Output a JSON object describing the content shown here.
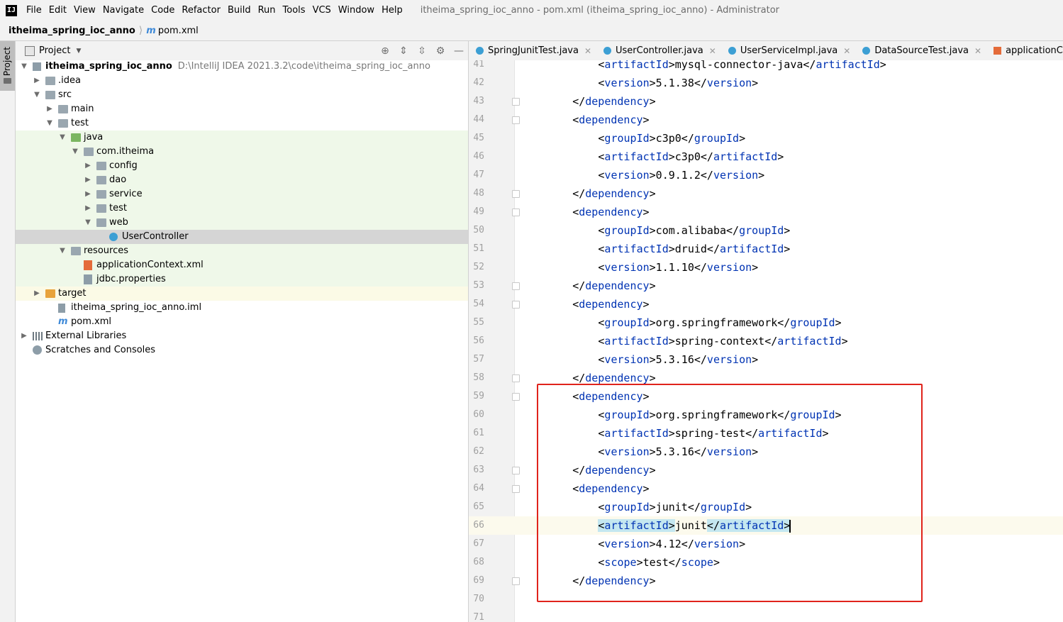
{
  "app": {
    "logo": "IJ",
    "menu": [
      "File",
      "Edit",
      "View",
      "Navigate",
      "Code",
      "Refactor",
      "Build",
      "Run",
      "Tools",
      "VCS",
      "Window",
      "Help"
    ],
    "window_title": "itheima_spring_ioc_anno - pom.xml (itheima_spring_ioc_anno) - Administrator"
  },
  "breadcrumb": {
    "project": "itheima_spring_ioc_anno",
    "file": "pom.xml",
    "file_icon": "m"
  },
  "toolstrip": {
    "project_label": "Project"
  },
  "project_panel": {
    "title": "Project",
    "header_icons": [
      "target-icon",
      "expand-all-icon",
      "collapse-all-icon",
      "gear-icon",
      "minimize-icon"
    ],
    "root": {
      "name": "itheima_spring_ioc_anno",
      "path": "D:\\IntelliJ IDEA 2021.3.2\\code\\itheima_spring_ioc_anno"
    },
    "tree": [
      {
        "label": ".idea",
        "depth": 1,
        "arrow": "right",
        "icon": "folder",
        "bg": ""
      },
      {
        "label": "src",
        "depth": 1,
        "arrow": "down",
        "icon": "folder",
        "bg": ""
      },
      {
        "label": "main",
        "depth": 2,
        "arrow": "right",
        "icon": "folder",
        "bg": ""
      },
      {
        "label": "test",
        "depth": 2,
        "arrow": "down",
        "icon": "folder",
        "bg": ""
      },
      {
        "label": "java",
        "depth": 3,
        "arrow": "down",
        "icon": "folder-green",
        "bg": "green"
      },
      {
        "label": "com.itheima",
        "depth": 4,
        "arrow": "down",
        "icon": "folder",
        "bg": "green"
      },
      {
        "label": "config",
        "depth": 5,
        "arrow": "right",
        "icon": "folder",
        "bg": "green"
      },
      {
        "label": "dao",
        "depth": 5,
        "arrow": "right",
        "icon": "folder",
        "bg": "green"
      },
      {
        "label": "service",
        "depth": 5,
        "arrow": "right",
        "icon": "folder",
        "bg": "green"
      },
      {
        "label": "test",
        "depth": 5,
        "arrow": "right",
        "icon": "folder",
        "bg": "green"
      },
      {
        "label": "web",
        "depth": 5,
        "arrow": "down",
        "icon": "folder",
        "bg": "green"
      },
      {
        "label": "UserController",
        "depth": 6,
        "arrow": "",
        "icon": "class",
        "bg": "selected"
      },
      {
        "label": "resources",
        "depth": 3,
        "arrow": "down",
        "icon": "folder-res",
        "bg": "green"
      },
      {
        "label": "applicationContext.xml",
        "depth": 4,
        "arrow": "",
        "icon": "xml",
        "bg": "green"
      },
      {
        "label": "jdbc.properties",
        "depth": 4,
        "arrow": "",
        "icon": "props",
        "bg": "green"
      },
      {
        "label": "target",
        "depth": 1,
        "arrow": "right",
        "icon": "folder-orange",
        "bg": "yellow"
      },
      {
        "label": "itheima_spring_ioc_anno.iml",
        "depth": 2,
        "arrow": "",
        "icon": "iml",
        "bg": ""
      },
      {
        "label": "pom.xml",
        "depth": 2,
        "arrow": "",
        "icon": "maven",
        "bg": ""
      },
      {
        "label": "External Libraries",
        "depth": 0,
        "arrow": "right",
        "icon": "lib",
        "bg": ""
      },
      {
        "label": "Scratches and Consoles",
        "depth": 0,
        "arrow": "",
        "icon": "scratch",
        "bg": ""
      }
    ]
  },
  "editor": {
    "tabs": [
      {
        "label": "SpringJunitTest.java",
        "icon": "class"
      },
      {
        "label": "UserController.java",
        "icon": "class"
      },
      {
        "label": "UserServiceImpl.java",
        "icon": "class"
      },
      {
        "label": "DataSourceTest.java",
        "icon": "class"
      },
      {
        "label": "applicationContext.xml",
        "icon": "xml"
      }
    ],
    "lines": [
      {
        "n": "41",
        "indent": 2,
        "open": "artifactId",
        "text": "mysql-connector-java",
        "fold": false
      },
      {
        "n": "42",
        "indent": 2,
        "open": "version",
        "text": "5.1.38",
        "fold": false
      },
      {
        "n": "43",
        "indent": 1,
        "close": "dependency",
        "fold": true
      },
      {
        "n": "44",
        "indent": 1,
        "tagonly": "dependency",
        "fold": true
      },
      {
        "n": "45",
        "indent": 2,
        "open": "groupId",
        "text": "c3p0",
        "fold": false
      },
      {
        "n": "46",
        "indent": 2,
        "open": "artifactId",
        "text": "c3p0",
        "fold": false
      },
      {
        "n": "47",
        "indent": 2,
        "open": "version",
        "text": "0.9.1.2",
        "fold": false
      },
      {
        "n": "48",
        "indent": 1,
        "close": "dependency",
        "fold": true
      },
      {
        "n": "49",
        "indent": 1,
        "tagonly": "dependency",
        "fold": true
      },
      {
        "n": "50",
        "indent": 2,
        "open": "groupId",
        "text": "com.alibaba",
        "fold": false
      },
      {
        "n": "51",
        "indent": 2,
        "open": "artifactId",
        "text": "druid",
        "fold": false
      },
      {
        "n": "52",
        "indent": 2,
        "open": "version",
        "text": "1.1.10",
        "fold": false
      },
      {
        "n": "53",
        "indent": 1,
        "close": "dependency",
        "fold": true
      },
      {
        "n": "54",
        "indent": 1,
        "tagonly": "dependency",
        "fold": true
      },
      {
        "n": "55",
        "indent": 2,
        "open": "groupId",
        "text": "org.springframework",
        "fold": false
      },
      {
        "n": "56",
        "indent": 2,
        "open": "artifactId",
        "text": "spring-context",
        "fold": false
      },
      {
        "n": "57",
        "indent": 2,
        "open": "version",
        "text": "5.3.16",
        "fold": false
      },
      {
        "n": "58",
        "indent": 1,
        "close": "dependency",
        "fold": true
      },
      {
        "n": "59",
        "indent": 1,
        "tagonly": "dependency",
        "fold": true
      },
      {
        "n": "60",
        "indent": 2,
        "open": "groupId",
        "text": "org.springframework",
        "fold": false
      },
      {
        "n": "61",
        "indent": 2,
        "open": "artifactId",
        "text": "spring-test",
        "fold": false
      },
      {
        "n": "62",
        "indent": 2,
        "open": "version",
        "text": "5.3.16",
        "fold": false
      },
      {
        "n": "63",
        "indent": 1,
        "close": "dependency",
        "fold": true
      },
      {
        "n": "64",
        "indent": 1,
        "tagonly": "dependency",
        "fold": true
      },
      {
        "n": "65",
        "indent": 2,
        "open": "groupId",
        "text": "junit",
        "fold": false
      },
      {
        "n": "66",
        "indent": 2,
        "open": "artifactId",
        "text": "junit",
        "fold": false,
        "current": true
      },
      {
        "n": "67",
        "indent": 2,
        "open": "version",
        "text": "4.12",
        "fold": false
      },
      {
        "n": "68",
        "indent": 2,
        "open": "scope",
        "text": "test",
        "fold": false
      },
      {
        "n": "69",
        "indent": 1,
        "close": "dependency",
        "fold": true
      },
      {
        "n": "70",
        "indent": 0,
        "fold": false
      },
      {
        "n": "71",
        "indent": 0,
        "fold": false
      }
    ]
  },
  "colors": {
    "tag": "#0033b3",
    "highlight_box": "#e0231b",
    "test_source_bg": "#eff8e9"
  }
}
